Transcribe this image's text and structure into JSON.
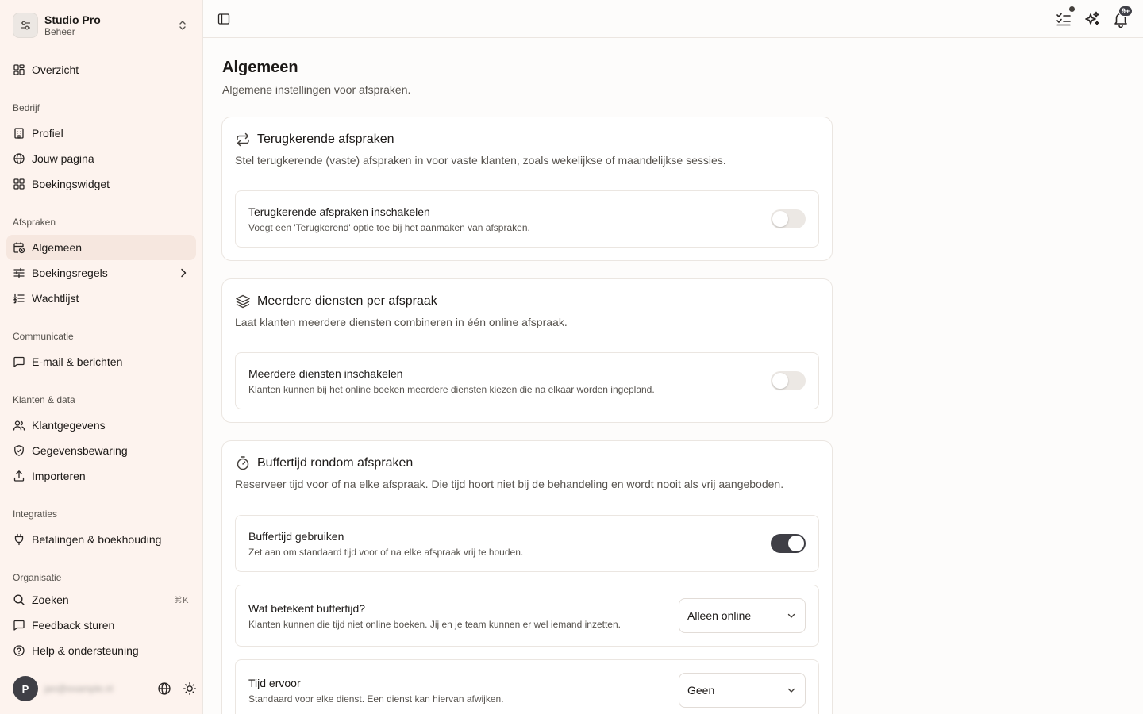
{
  "workspace": {
    "name": "Studio Pro",
    "role": "Beheer"
  },
  "sidebar": {
    "overview": "Overzicht",
    "groups": {
      "company": "Bedrijf",
      "appointments": "Afspraken",
      "communication": "Communicatie",
      "clients": "Klanten & data",
      "integrations": "Integraties",
      "organisation": "Organisatie"
    },
    "items": {
      "profile": "Profiel",
      "your_page": "Jouw pagina",
      "booking_widget": "Boekingswidget",
      "general": "Algemeen",
      "booking_rules": "Boekingsregels",
      "waitlist": "Wachtlijst",
      "email": "E-mail & berichten",
      "client_data": "Klantgegevens",
      "data_retention": "Gegevensbewaring",
      "import": "Importeren",
      "payments": "Betalingen & boekhouding",
      "search": "Zoeken",
      "search_shortcut": "⌘K",
      "feedback": "Feedback sturen",
      "help": "Help & ondersteuning"
    },
    "user": {
      "initial": "P",
      "email": "jan@example.nl"
    }
  },
  "topbar": {
    "notifications_badge": "9+"
  },
  "page": {
    "title": "Algemeen",
    "subtitle": "Algemene instellingen voor afspraken."
  },
  "cards": {
    "recurring": {
      "title": "Terugkerende afspraken",
      "description": "Stel terugkerende (vaste) afspraken in voor vaste klanten, zoals wekelijkse of maandelijkse sessies.",
      "setting_title": "Terugkerende afspraken inschakelen",
      "setting_desc": "Voegt een 'Terugkerend' optie toe bij het aanmaken van afspraken.",
      "enabled": false
    },
    "multi": {
      "title": "Meerdere diensten per afspraak",
      "description": "Laat klanten meerdere diensten combineren in één online afspraak.",
      "setting_title": "Meerdere diensten inschakelen",
      "setting_desc": "Klanten kunnen bij het online boeken meerdere diensten kiezen die na elkaar worden ingepland.",
      "enabled": false
    },
    "buffer": {
      "title": "Buffertijd rondom afspraken",
      "description": "Reserveer tijd voor of na elke afspraak. Die tijd hoort niet bij de behandeling en wordt nooit als vrij aangeboden.",
      "use_title": "Buffertijd gebruiken",
      "use_desc": "Zet aan om standaard tijd voor of na elke afspraak vrij te houden.",
      "enabled": true,
      "meaning_title": "Wat betekent buffertijd?",
      "meaning_desc": "Klanten kunnen die tijd niet online boeken. Jij en je team kunnen er wel iemand inzetten.",
      "meaning_value": "Alleen online",
      "before_title": "Tijd ervoor",
      "before_desc": "Standaard voor elke dienst. Een dienst kan hiervan afwijken.",
      "before_value": "Geen"
    }
  },
  "colors": {
    "sidebar_bg": "#fdf3ee",
    "active_item_bg": "#f6e7df",
    "toggle_on": "#3f3f46",
    "toggle_off": "#ece8e4"
  }
}
